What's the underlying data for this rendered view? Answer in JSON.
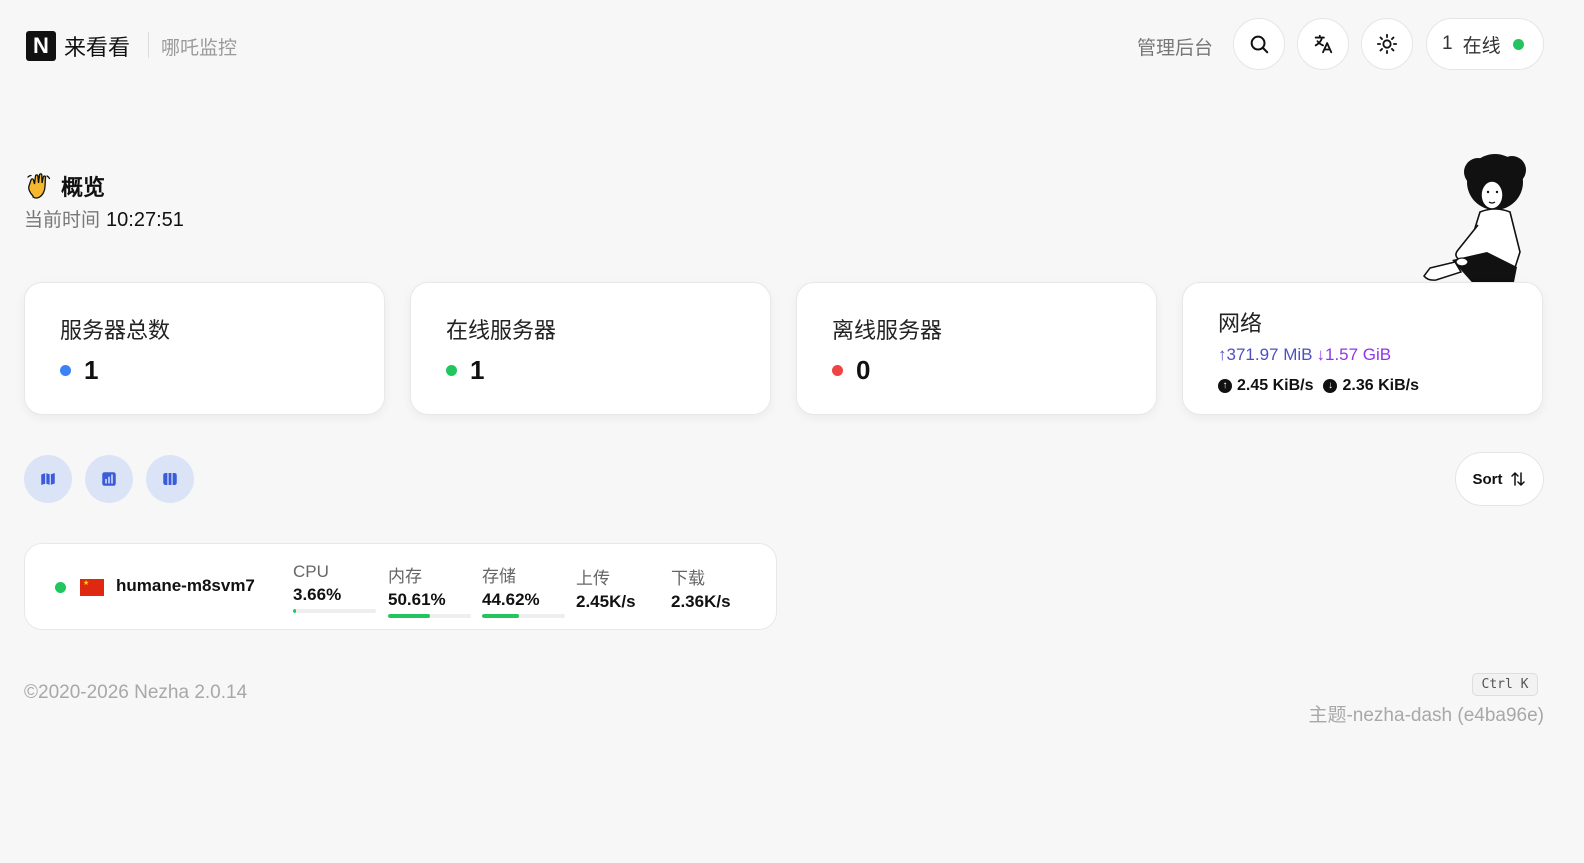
{
  "header": {
    "logo_letter": "N",
    "site_title": "来看看",
    "site_subtitle": "哪吒监控",
    "admin_label": "管理后台",
    "online_count": "1",
    "online_label": "在线"
  },
  "overview": {
    "title": "概览",
    "time_label": "当前时间",
    "time_value": "10:27:51"
  },
  "stats": {
    "total_label": "服务器总数",
    "total_value": "1",
    "online_label": "在线服务器",
    "online_value": "1",
    "offline_label": "离线服务器",
    "offline_value": "0",
    "network_label": "网络",
    "net_up_total": "↑371.97 MiB",
    "net_down_total": "↓1.57 GiB",
    "net_up_speed": "2.45 KiB/s",
    "net_down_speed": "2.36 KiB/s"
  },
  "toolbar": {
    "sort_label": "Sort"
  },
  "server": {
    "name": "humane-m8svm7",
    "country": "CN",
    "cpu_label": "CPU",
    "cpu_value": "3.66%",
    "cpu_percent": 3.66,
    "mem_label": "内存",
    "mem_value": "50.61%",
    "mem_percent": 50.61,
    "disk_label": "存储",
    "disk_value": "44.62%",
    "disk_percent": 44.62,
    "up_label": "上传",
    "up_value": "2.45K/s",
    "down_label": "下载",
    "down_value": "2.36K/s"
  },
  "footer": {
    "copyright": "©2020-2026 Nezha 2.0.14",
    "shortcut": "Ctrl K",
    "theme": "主题-nezha-dash (e4ba96e)"
  },
  "colors": {
    "online": "#22c55e",
    "offline": "#ef4444",
    "total": "#3b82f6",
    "accent_bg": "#dbe4f7",
    "accent_icon": "#3b5bdb"
  }
}
